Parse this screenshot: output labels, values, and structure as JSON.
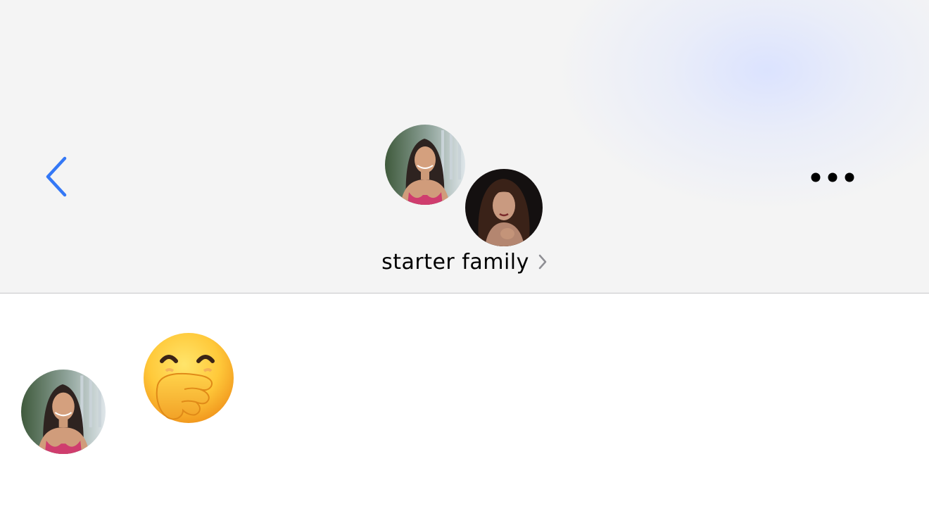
{
  "header": {
    "group_name": "starter family",
    "back_icon": "chevron-left-icon",
    "more_icon": "ellipsis-icon",
    "title_chevron_icon": "chevron-right-icon",
    "accent_color": "#3478f6"
  },
  "message": {
    "content": "🤭",
    "emoji_name": "face-with-hand-over-mouth"
  }
}
